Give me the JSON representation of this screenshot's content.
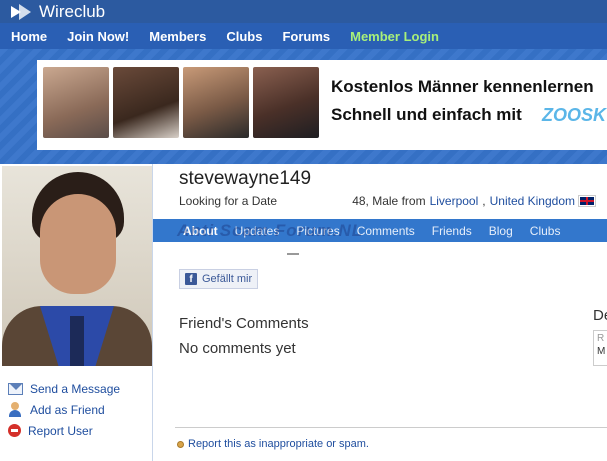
{
  "brand": {
    "name": "Wireclub"
  },
  "nav": {
    "items": [
      "Home",
      "Join Now!",
      "Members",
      "Clubs",
      "Forums"
    ],
    "login": "Member Login"
  },
  "ad": {
    "line1": "Kostenlos Männer kennenlernen",
    "line2": "Schnell und einfach mit",
    "logo": "ZOOSK"
  },
  "profile": {
    "username": "stevewayne149",
    "tagline": "Looking for a Date",
    "meta_prefix": "48, Male from",
    "city": "Liverpool",
    "country": "United Kingdom",
    "flag_icon": "uk-flag-icon"
  },
  "actions": [
    {
      "label": "Send a Message",
      "icon": "envelope-icon"
    },
    {
      "label": "Add as Friend",
      "icon": "add-friend-icon"
    },
    {
      "label": "Report User",
      "icon": "report-icon"
    }
  ],
  "tabs": [
    "About",
    "Updates",
    "Pictures",
    "Comments",
    "Friends",
    "Blog",
    "Clubs"
  ],
  "watermark": "Anti Scam Forum.NL",
  "like": {
    "label": "Gefällt mir",
    "icon": "facebook-icon"
  },
  "comments": {
    "title": "Friend's Comments",
    "empty": "No comments yet"
  },
  "sidebar": {
    "heading": "De",
    "box_label": "R",
    "box_value": "M"
  },
  "report_spam": "Report this as inappropriate or spam.",
  "colors": {
    "topbar": "#2c5aa0",
    "nav": "#2a5fb4",
    "tabs": "#3377cc",
    "login": "#a8f07a",
    "link": "#1e4d9e"
  }
}
